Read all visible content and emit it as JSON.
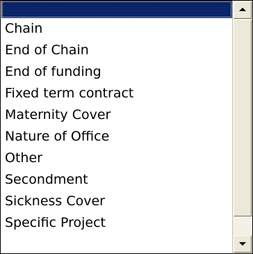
{
  "dropdown": {
    "selected_index": 0,
    "options": [
      "",
      "Chain",
      "End of Chain",
      "End of funding",
      "Fixed term contract",
      "Maternity Cover",
      "Nature of Office",
      "Other",
      "Secondment",
      "Sickness Cover",
      "Specific Project"
    ]
  },
  "colors": {
    "selection": "#0a246a",
    "scrollbar": "#ece9d8"
  },
  "icons": {
    "scroll_up": "triangle-up",
    "scroll_down": "triangle-down"
  }
}
